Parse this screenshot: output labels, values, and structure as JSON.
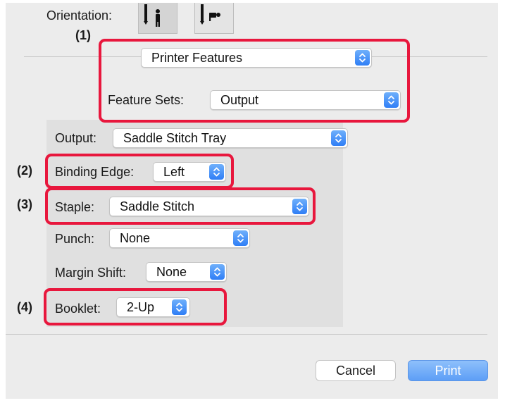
{
  "orientation": {
    "label": "Orientation:",
    "options": [
      "portrait-icon",
      "landscape-icon"
    ],
    "selected": "portrait-icon"
  },
  "callouts": {
    "c1": "(1)",
    "c2": "(2)",
    "c3": "(3)",
    "c4": "(4)"
  },
  "section_popup": {
    "value": "Printer Features"
  },
  "feature_sets": {
    "label": "Feature Sets:",
    "value": "Output"
  },
  "output": {
    "label": "Output:",
    "value": "Saddle Stitch Tray"
  },
  "binding_edge": {
    "label": "Binding Edge:",
    "value": "Left"
  },
  "staple": {
    "label": "Staple:",
    "value": "Saddle Stitch"
  },
  "punch": {
    "label": "Punch:",
    "value": "None"
  },
  "margin_shift": {
    "label": "Margin Shift:",
    "value": "None"
  },
  "booklet": {
    "label": "Booklet:",
    "value": "2-Up"
  },
  "buttons": {
    "cancel": "Cancel",
    "print": "Print"
  },
  "colors": {
    "highlight": "#e8173d",
    "accent": "#2f7ef6",
    "dialog_bg": "#ececec"
  }
}
